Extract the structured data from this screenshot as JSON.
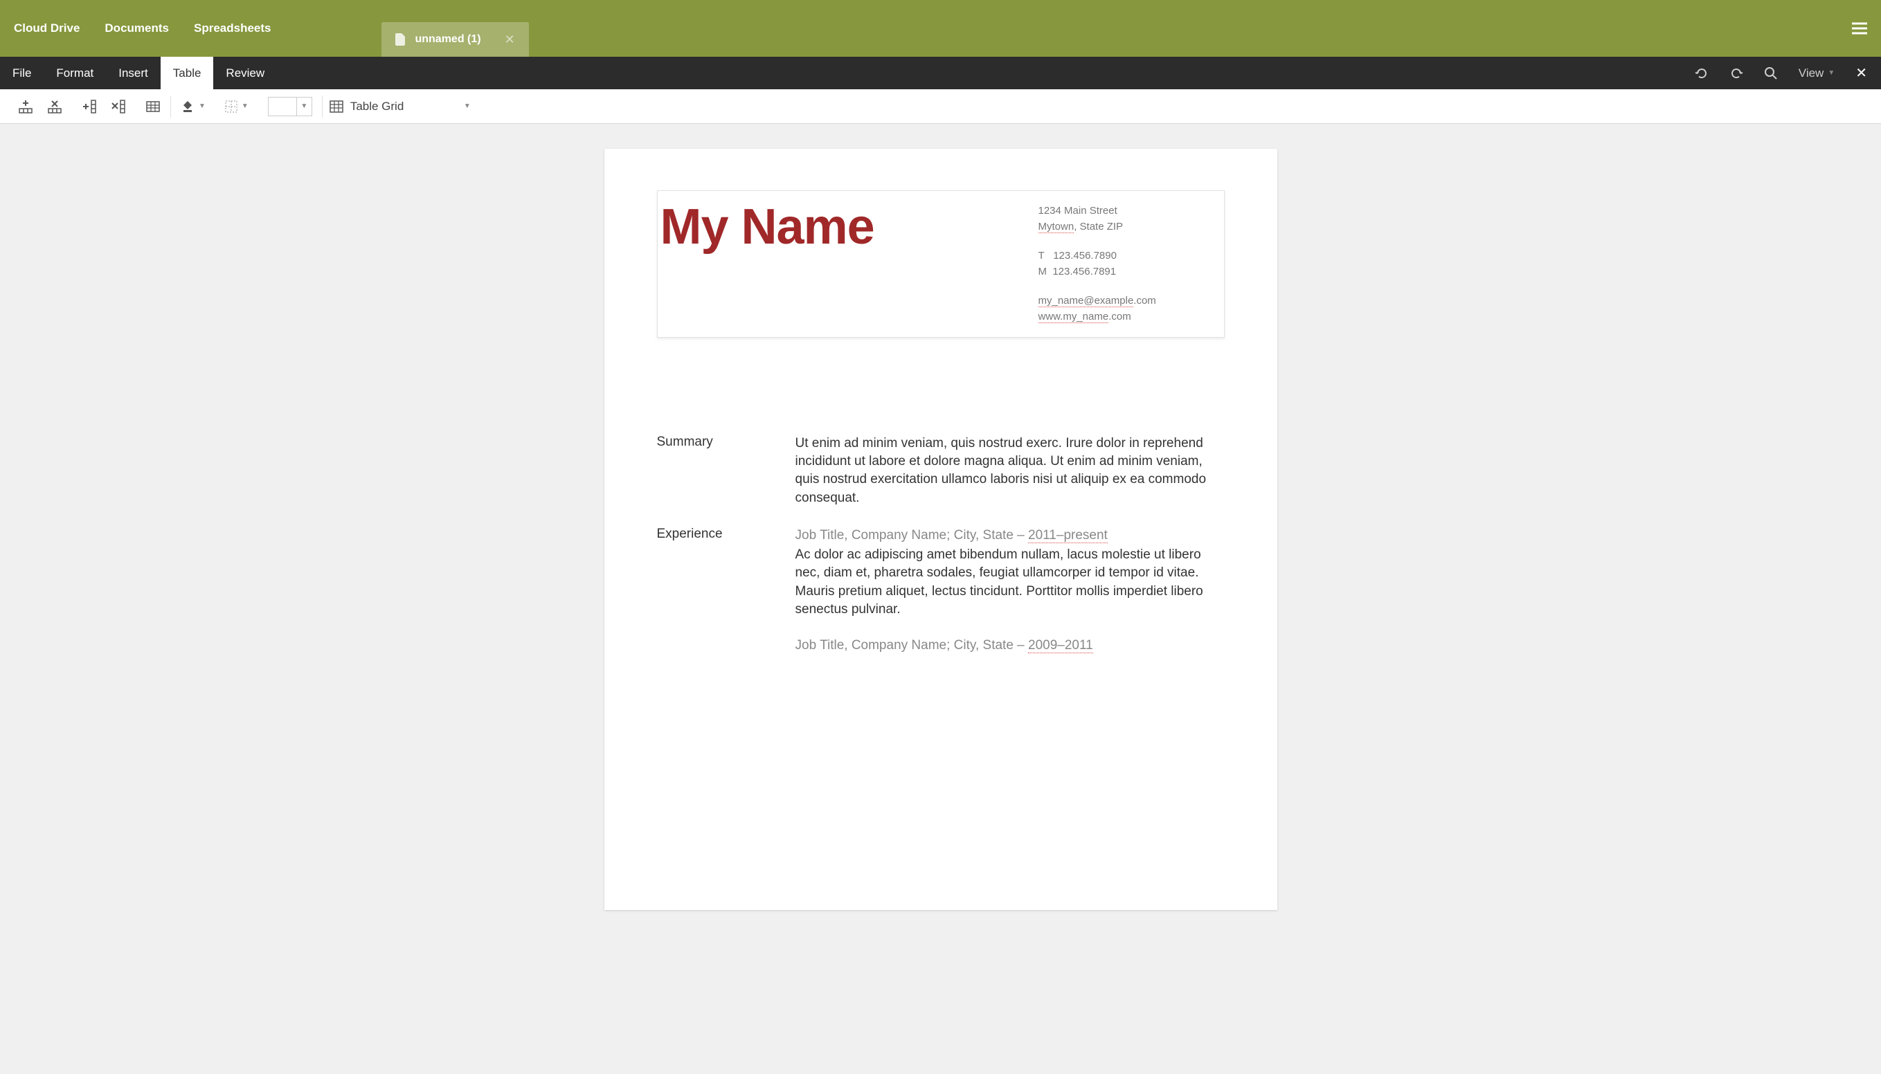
{
  "topNav": {
    "cloudDrive": "Cloud Drive",
    "documents": "Documents",
    "spreadsheets": "Spreadsheets"
  },
  "docTab": {
    "title": "unnamed (1)"
  },
  "menuBar": {
    "file": "File",
    "format": "Format",
    "insert": "Insert",
    "table": "Table",
    "review": "Review",
    "view": "View"
  },
  "toolbar": {
    "tableStyleLabel": "Table Grid"
  },
  "document": {
    "name": "My Name",
    "contact": {
      "street": "1234 Main Street",
      "city": "Mytown",
      "stateZip": ", State ZIP",
      "phoneT_label": "T",
      "phoneT": "123.456.7890",
      "phoneM_label": "M",
      "phoneM": "123.456.7891",
      "email_prefix": "my_name@example",
      "email_suffix": ".com",
      "web_prefix": "www.my_name",
      "web_suffix": ".com"
    },
    "sections": {
      "summary": {
        "label": "Summary",
        "text": "Ut enim ad minim veniam, quis nostrud exerc. Irure dolor in reprehend incididunt ut labore et dolore magna aliqua. Ut enim ad minim veniam, quis nostrud exercitation ullamco laboris nisi ut aliquip ex ea commodo consequat."
      },
      "experience": {
        "label": "Experience",
        "jobs": [
          {
            "header_prefix": "Job Title, Company Name; City, State – ",
            "dates": "2011–present",
            "body": "Ac dolor ac adipiscing amet bibendum nullam, lacus molestie ut libero nec, diam et, pharetra sodales, feugiat ullamcorper id tempor id vitae. Mauris pretium aliquet, lectus tincidunt. Porttitor mollis imperdiet libero senectus pulvinar."
          },
          {
            "header_prefix": "Job Title, Company Name; City, State – ",
            "dates": "2009–2011",
            "body": ""
          }
        ]
      }
    }
  }
}
